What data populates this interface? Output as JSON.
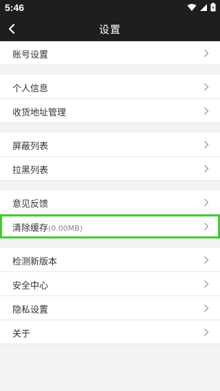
{
  "status": {
    "time": "5:46"
  },
  "nav": {
    "title": "设置"
  },
  "groups": [
    {
      "items": [
        "账号设置"
      ]
    },
    {
      "items": [
        "个人信息",
        "收货地址管理"
      ]
    },
    {
      "items": [
        "屏蔽列表",
        "拉黑列表"
      ]
    },
    {
      "items": [
        "意见反馈"
      ]
    },
    {
      "items": [
        "清除缓存",
        "检测新版本",
        "安全中心",
        "隐私设置",
        "关于"
      ]
    }
  ],
  "cache_size": "(0.00MB)",
  "colors": {
    "bar": "#1e1e1e",
    "highlight": "#3fcd2d",
    "background": "#f3f3f3"
  }
}
